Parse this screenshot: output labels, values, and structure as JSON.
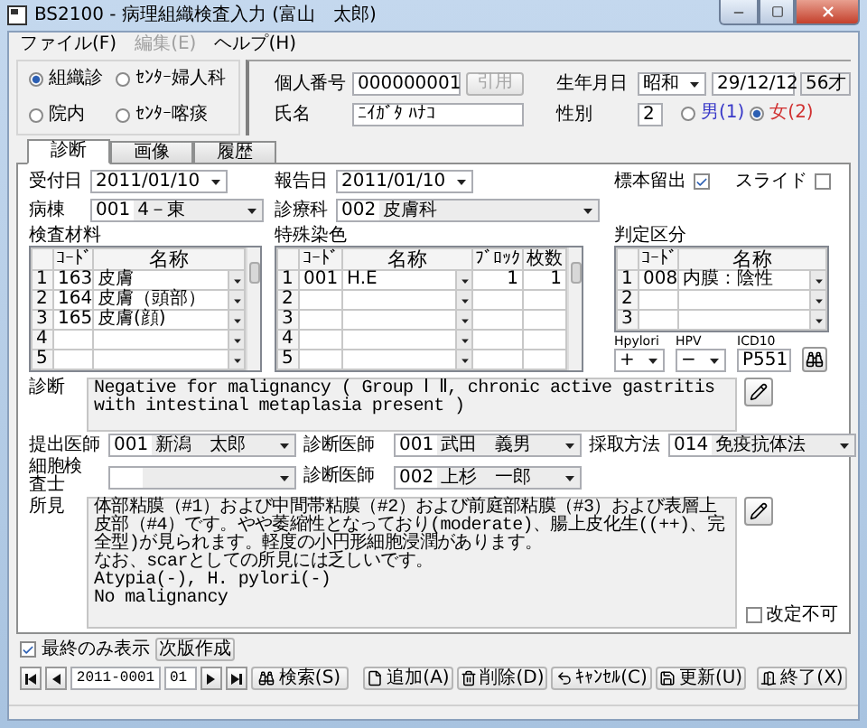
{
  "window": {
    "title": "BS2100 - 病理組織検査入力 (富山　太郎)"
  },
  "menu": [
    {
      "label": "ファイル(F)",
      "disabled": false
    },
    {
      "label": "編集(E)",
      "disabled": true
    },
    {
      "label": "ヘルプ(H)",
      "disabled": false
    }
  ],
  "exam_types": [
    {
      "label": "組織診",
      "selected": true
    },
    {
      "label": "ｾﾝﾀｰ婦人科",
      "selected": false
    },
    {
      "label": "院内",
      "selected": false
    },
    {
      "label": "ｾﾝﾀｰ喀痰",
      "selected": false
    }
  ],
  "patient": {
    "id_label": "個人番号",
    "id": "000000001",
    "cite_button": {
      "label": "引用",
      "disabled": true
    },
    "birth_label": "生年月日",
    "era": "昭和",
    "birth_date": "29/12/12",
    "age": "56才",
    "name_label": "氏名",
    "name": "ﾆｲｶﾞﾀ ﾊﾅｺ",
    "sex_label": "性別",
    "sex_code": "2",
    "sex_options": [
      {
        "label": "男(1)",
        "selected": false,
        "color": "#3838c8"
      },
      {
        "label": "女(2)",
        "selected": true,
        "color": "#d03030"
      }
    ]
  },
  "tabs": [
    {
      "label": "診断",
      "selected": true
    },
    {
      "label": "画像",
      "selected": false
    },
    {
      "label": "履歴",
      "selected": false
    }
  ],
  "diagnosis": {
    "received_date": {
      "label": "受付日",
      "value": "2011/01/10"
    },
    "report_date": {
      "label": "報告日",
      "value": "2011/01/10"
    },
    "flags": [
      {
        "label": "標本留出",
        "checked": true
      },
      {
        "label": "スライド",
        "checked": false
      }
    ],
    "ward": {
      "label": "病棟",
      "code": "001",
      "value": "4－東"
    },
    "department": {
      "label": "診療科",
      "code": "002",
      "value": "皮膚科"
    },
    "materials": {
      "label": "検査材料",
      "columns": [
        "ｺｰﾄﾞ",
        "名称"
      ],
      "rows": [
        {
          "no": "1",
          "code": "163",
          "name": "皮膚"
        },
        {
          "no": "2",
          "code": "164",
          "name": "皮膚（頭部）"
        },
        {
          "no": "3",
          "code": "165",
          "name": "皮膚(顔)"
        },
        {
          "no": "4"
        },
        {
          "no": "5"
        }
      ]
    },
    "stains": {
      "label": "特殊染色",
      "columns": [
        "ｺｰﾄﾞ",
        "名称",
        "ﾌﾞﾛｯｸ",
        "枚数"
      ],
      "rows": [
        {
          "no": "1",
          "code": "001",
          "name": "H.E",
          "blocks": "1",
          "sheets": "1"
        },
        {
          "no": "2"
        },
        {
          "no": "3"
        },
        {
          "no": "4"
        },
        {
          "no": "5"
        }
      ]
    },
    "judgement": {
      "label": "判定区分",
      "columns": [
        "ｺｰﾄﾞ",
        "名称"
      ],
      "rows": [
        {
          "no": "1",
          "code": "008",
          "name": "内膜：陰性"
        },
        {
          "no": "2"
        },
        {
          "no": "3"
        }
      ]
    },
    "hpylori": {
      "label": "Hpylori",
      "value": "+"
    },
    "hpv": {
      "label": "HPV",
      "value": "−"
    },
    "icd10": {
      "label": "ICD10",
      "value": "P551"
    },
    "diagnosis_text": {
      "label": "診断",
      "text": "Negative for malignancy ( Group Ⅰ Ⅱ, chronic active gastritis with intestinal metaplasia present )"
    },
    "staff": [
      {
        "label": "提出医師",
        "code": "001",
        "value": "新潟　太郎"
      },
      {
        "label": "診断医師",
        "code": "001",
        "value": "武田　義男"
      },
      {
        "label": "採取方法",
        "code": "014",
        "value": "免疫抗体法"
      },
      {
        "label": "細胞検査士"
      },
      {
        "label": "診断医師",
        "code": "002",
        "value": "上杉　一郎"
      }
    ],
    "findings": {
      "label": "所見",
      "paragraphs": [
        "体部粘膜（#1）および中間帯粘膜（#2）および前庭部粘膜（#3）および表層上皮部（#4）です。やや萎縮性となっており(moderate)、腸上皮化生((++)、完全型)が見られます。軽度の小円形細胞浸潤があります。",
        "なお、scarとしての所見には乏しいです。",
        "Atypia(-), H. pylori(-)",
        "No malignancy"
      ]
    },
    "no_revision": {
      "label": "改定不可",
      "checked": false
    }
  },
  "footer": {
    "latest_only": {
      "label": "最終のみ表示",
      "checked": true
    },
    "next_version_button": "次版作成",
    "record_no": "2011-0001",
    "version": "01",
    "search_button": "検索(S)",
    "actions": [
      {
        "label": "追加(A)",
        "kind": "add"
      },
      {
        "label": "削除(D)",
        "kind": "delete"
      },
      {
        "label": "ｷｬﾝｾﾙ(C)",
        "kind": "cancel"
      },
      {
        "label": "更新(U)",
        "kind": "save"
      },
      {
        "label": "終了(X)",
        "kind": "exit"
      }
    ]
  }
}
